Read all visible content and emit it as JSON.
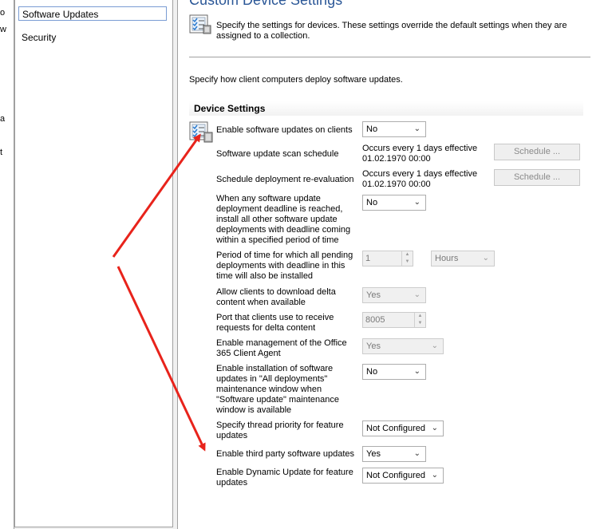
{
  "left_strip": {
    "fragments": [
      "o",
      "w",
      "a",
      "t"
    ]
  },
  "nav": {
    "items": [
      {
        "label": "Software Updates",
        "selected": true
      },
      {
        "label": "Security",
        "selected": false
      }
    ]
  },
  "content": {
    "title": "Custom Device Settings",
    "header_description": "Specify the settings for devices. These settings override the default settings when they are assigned to a collection.",
    "page_description": "Specify how client computers deploy software updates.",
    "section_title": "Device Settings",
    "settings": [
      {
        "label": "Enable software updates on clients",
        "value": "No"
      },
      {
        "label": "Software update scan schedule",
        "value": "Occurs every 1 days effective 01.02.1970 00:00",
        "button": "Schedule ..."
      },
      {
        "label": "Schedule deployment re-evaluation",
        "value": "Occurs every 1 days effective 01.02.1970 00:00",
        "button": "Schedule ..."
      },
      {
        "label": "When any software update deployment deadline is reached, install all other software update deployments with deadline coming within a specified period of time",
        "value": "No"
      },
      {
        "label": "Period of time for which all pending deployments with deadline in this time will also be installed",
        "value": "1",
        "unit": "Hours"
      },
      {
        "label": "Allow clients to download delta content when available",
        "value": "Yes"
      },
      {
        "label": "Port that clients use to receive requests for delta content",
        "value": "8005"
      },
      {
        "label": "Enable management of the Office 365 Client Agent",
        "value": "Yes"
      },
      {
        "label": "Enable installation of software updates in \"All deployments\" maintenance window when \"Software update\" maintenance window is available",
        "value": "No"
      },
      {
        "label": "Specify thread priority for feature updates",
        "value": "Not Configured"
      },
      {
        "label": "Enable third party software updates",
        "value": "Yes"
      },
      {
        "label": "Enable Dynamic Update for feature updates",
        "value": "Not Configured"
      }
    ]
  },
  "colors": {
    "arrow": "#e8231b",
    "title": "#2b5797"
  },
  "icons": {
    "header": "checklist-icon",
    "section": "checklist-icon"
  }
}
